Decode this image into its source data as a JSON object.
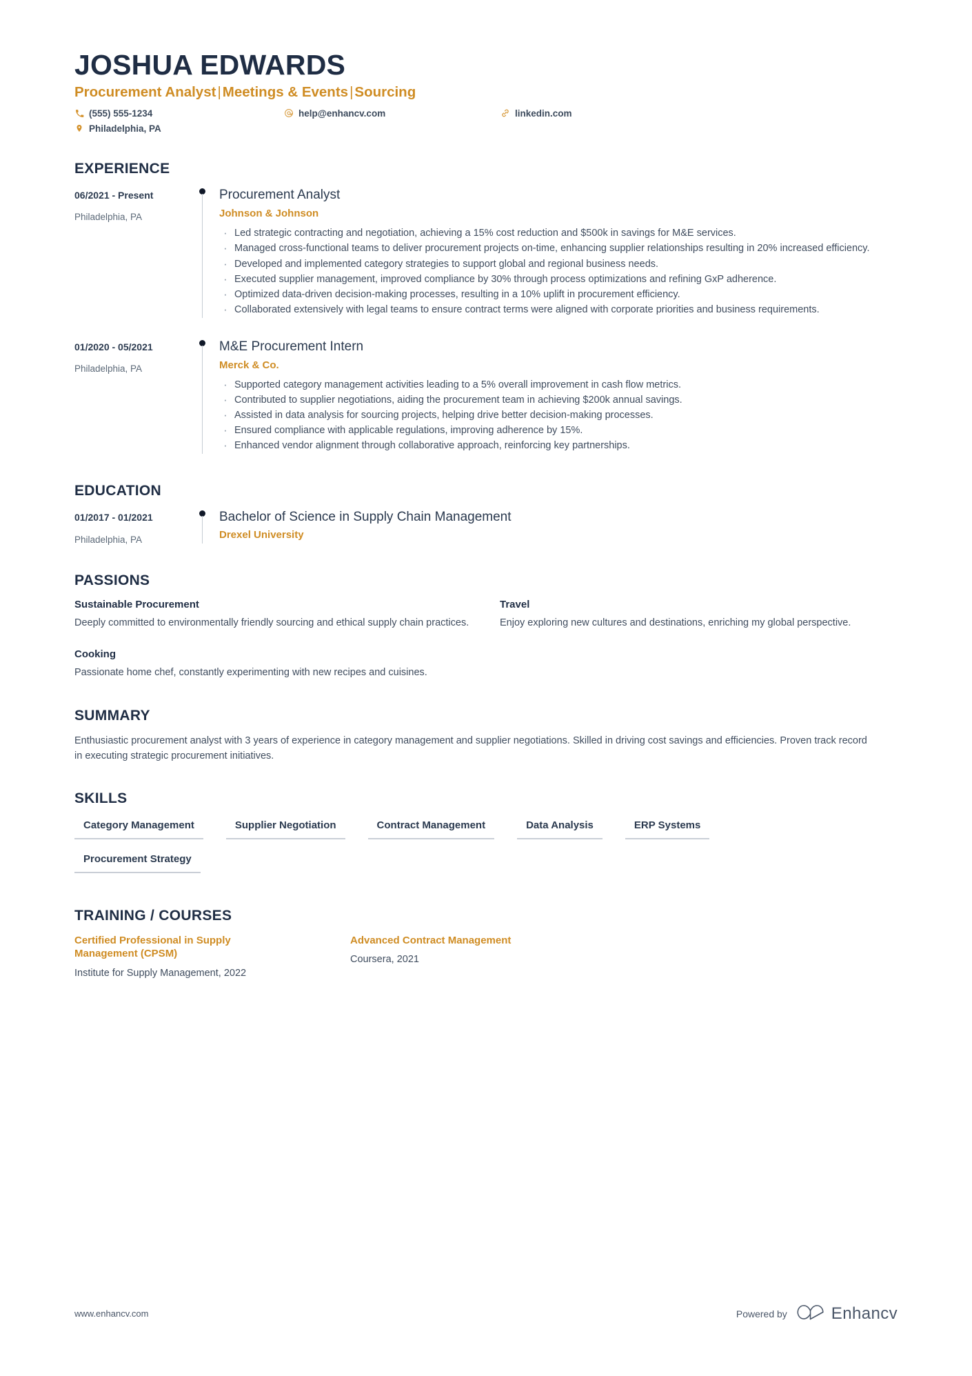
{
  "header": {
    "name": "JOSHUA EDWARDS",
    "headline_parts": [
      "Procurement Analyst",
      "Meetings & Events",
      "Sourcing"
    ],
    "headline_separator": "|",
    "contacts": [
      {
        "icon": "phone-icon",
        "value": "(555) 555-1234"
      },
      {
        "icon": "location-pin-icon",
        "value": "Philadelphia, PA"
      },
      {
        "icon": "email-at-icon",
        "value": "help@enhancv.com"
      },
      {
        "icon": "link-icon",
        "value": "linkedin.com"
      }
    ]
  },
  "experience": {
    "title": "EXPERIENCE",
    "entries": [
      {
        "date": "06/2021 - Present",
        "location": "Philadelphia, PA",
        "role": "Procurement Analyst",
        "company": "Johnson & Johnson",
        "bullets": [
          "Led strategic contracting and negotiation, achieving a 15% cost reduction and $500k in savings for M&E services.",
          "Managed cross-functional teams to deliver procurement projects on-time, enhancing supplier relationships resulting in 20% increased efficiency.",
          "Developed and implemented category strategies to support global and regional business needs.",
          "Executed supplier management, improved compliance by 30% through process optimizations and refining GxP adherence.",
          "Optimized data-driven decision-making processes, resulting in a 10% uplift in procurement efficiency.",
          "Collaborated extensively with legal teams to ensure contract terms were aligned with corporate priorities and business requirements."
        ]
      },
      {
        "date": "01/2020 - 05/2021",
        "location": "Philadelphia, PA",
        "role": "M&E Procurement Intern",
        "company": "Merck & Co.",
        "bullets": [
          "Supported category management activities leading to a 5% overall improvement in cash flow metrics.",
          "Contributed to supplier negotiations, aiding the procurement team in achieving $200k annual savings.",
          "Assisted in data analysis for sourcing projects, helping drive better decision-making processes.",
          "Ensured compliance with applicable regulations, improving adherence by 15%.",
          "Enhanced vendor alignment through collaborative approach, reinforcing key partnerships."
        ]
      }
    ]
  },
  "education": {
    "title": "EDUCATION",
    "entries": [
      {
        "date": "01/2017 - 01/2021",
        "location": "Philadelphia, PA",
        "degree": "Bachelor of Science in Supply Chain Management",
        "school": "Drexel University"
      }
    ]
  },
  "passions": {
    "title": "PASSIONS",
    "items": [
      {
        "name": "Sustainable Procurement",
        "description": "Deeply committed to environmentally friendly sourcing and ethical supply chain practices."
      },
      {
        "name": "Travel",
        "description": "Enjoy exploring new cultures and destinations, enriching my global perspective."
      },
      {
        "name": "Cooking",
        "description": "Passionate home chef, constantly experimenting with new recipes and cuisines."
      }
    ]
  },
  "summary": {
    "title": "SUMMARY",
    "text": "Enthusiastic procurement analyst with 3 years of experience in category management and supplier negotiations. Skilled in driving cost savings and efficiencies. Proven track record in executing strategic procurement initiatives."
  },
  "skills": {
    "title": "SKILLS",
    "items": [
      "Category Management",
      "Supplier Negotiation",
      "Contract Management",
      "Data Analysis",
      "ERP Systems",
      "Procurement Strategy"
    ]
  },
  "training": {
    "title": "TRAINING / COURSES",
    "items": [
      {
        "name": "Certified Professional in Supply Management (CPSM)",
        "issuer": "Institute for Supply Management, 2022"
      },
      {
        "name": "Advanced Contract Management",
        "issuer": "Coursera, 2021"
      }
    ]
  },
  "footer": {
    "url": "www.enhancv.com",
    "powered_by": "Powered by",
    "brand": "Enhancv",
    "brand_logo": "enhancv-infinity-logo"
  },
  "colors": {
    "accent_gold": "#cf8c23",
    "dark_navy": "#1f2d44",
    "body_text": "#3f4c5e",
    "muted_text": "#5b6877",
    "rule": "#c9ced6"
  }
}
